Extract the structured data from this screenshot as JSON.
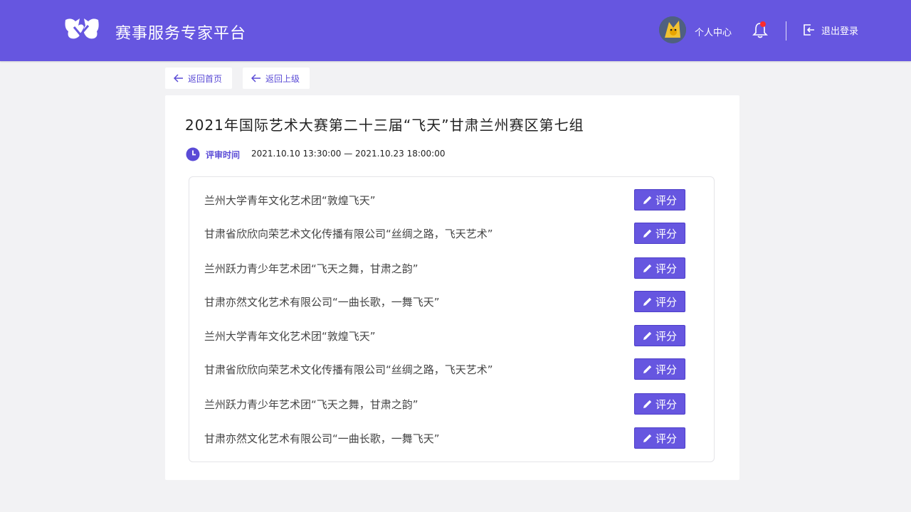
{
  "header": {
    "title": "赛事服务专家平台",
    "profile_label": "个人中心",
    "logout_label": "退出登录",
    "logo_icon": "winged-logo-icon",
    "brand_color": "#6656e0"
  },
  "nav": {
    "back_home_label": "返回首页",
    "back_up_label": "返回上级"
  },
  "event": {
    "title": "2021年国际艺术大赛第二十三届“飞天”甘肃兰州赛区第七组",
    "review_time_label": "评审时间",
    "review_time_range": "2021.10.10 13:30:00 — 2021.10.23 18:00:00"
  },
  "entries": [
    {
      "name": "兰州大学青年文化艺术团“敦煌飞天”",
      "action": "评分"
    },
    {
      "name": "甘肃省欣欣向荣艺术文化传播有限公司“丝绸之路，飞天艺术”",
      "action": "评分"
    },
    {
      "name": "兰州跃力青少年艺术团“飞天之舞，甘肃之韵”",
      "action": "评分"
    },
    {
      "name": "甘肃亦然文化艺术有限公司“一曲长歌，一舞飞天”",
      "action": "评分"
    },
    {
      "name": "兰州大学青年文化艺术团“敦煌飞天”",
      "action": "评分"
    },
    {
      "name": "甘肃省欣欣向荣艺术文化传播有限公司“丝绸之路，飞天艺术”",
      "action": "评分"
    },
    {
      "name": "兰州跃力青少年艺术团“飞天之舞，甘肃之韵”",
      "action": "评分"
    },
    {
      "name": "甘肃亦然文化艺术有限公司“一曲长歌，一舞飞天”",
      "action": "评分"
    }
  ]
}
